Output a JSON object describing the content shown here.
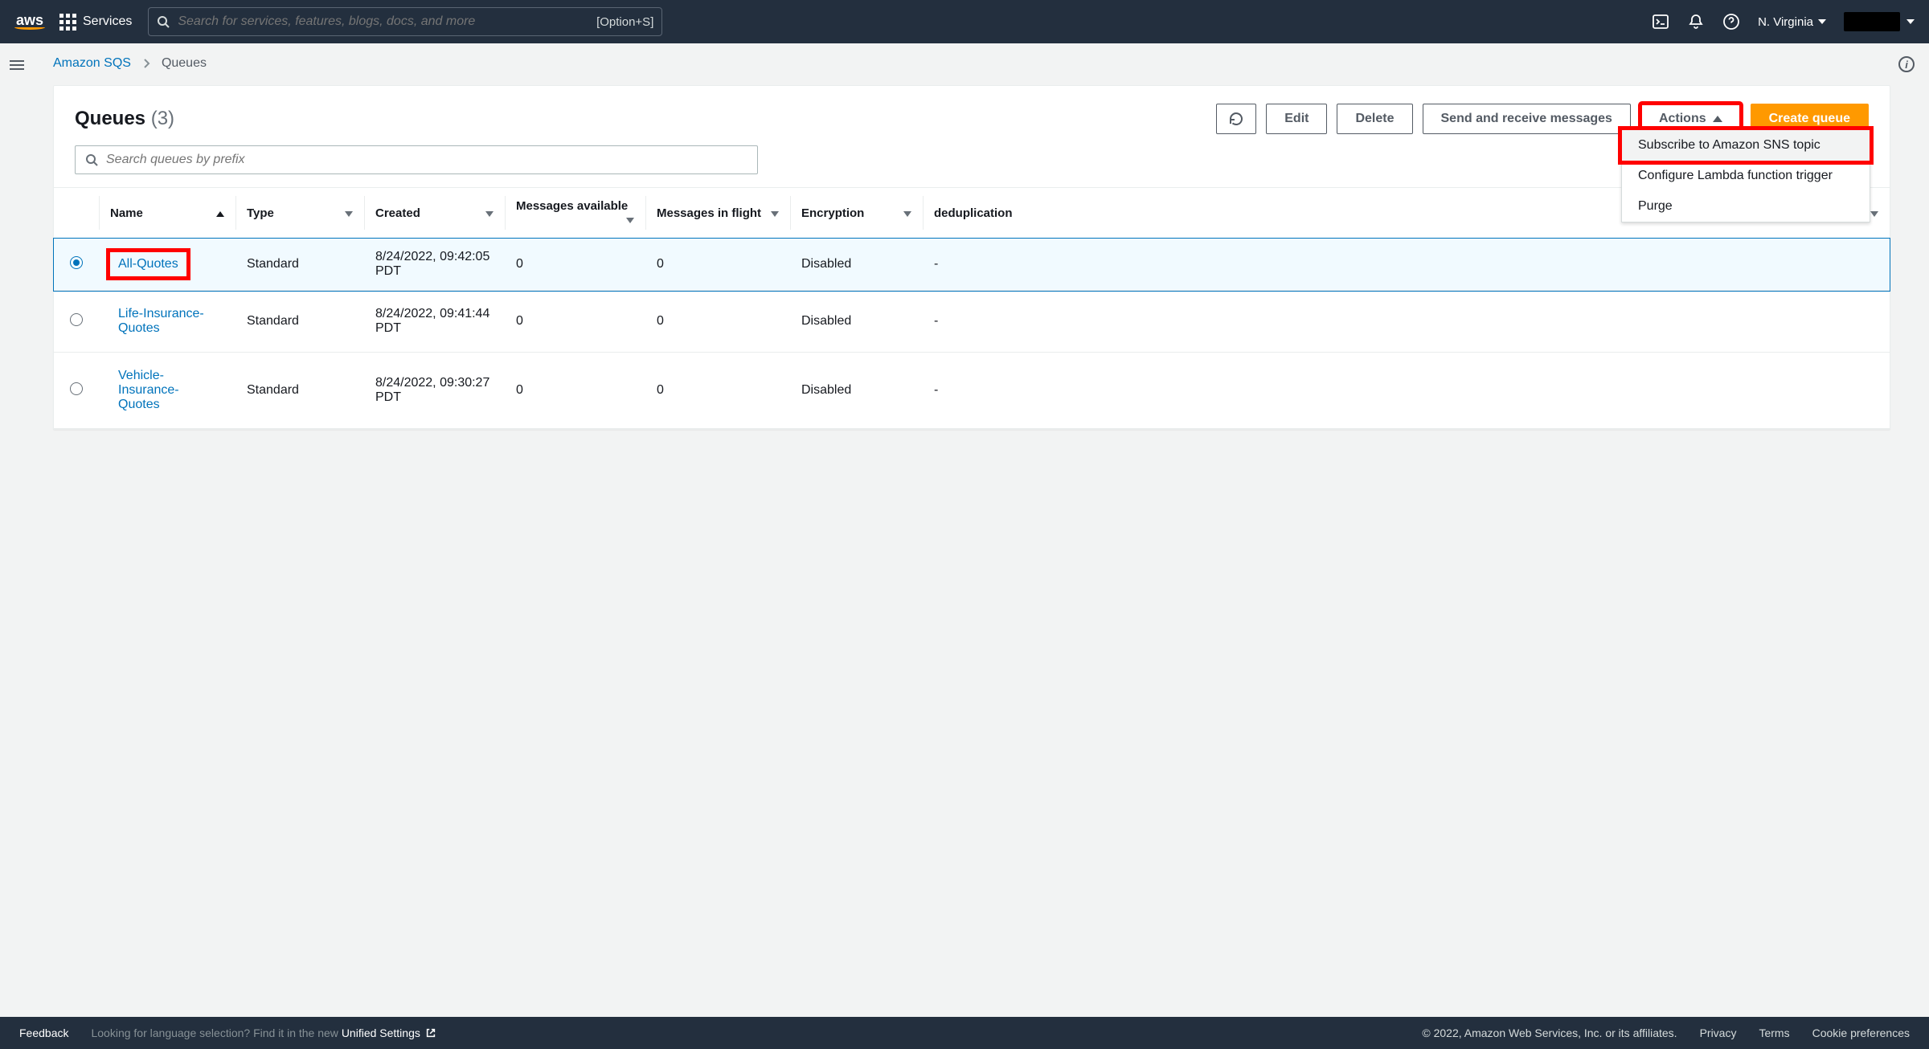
{
  "nav": {
    "logo": "aws",
    "services_label": "Services",
    "search_placeholder": "Search for services, features, blogs, docs, and more",
    "search_shortcut": "[Option+S]",
    "region": "N. Virginia"
  },
  "breadcrumb": {
    "root": "Amazon SQS",
    "current": "Queues"
  },
  "panel": {
    "title": "Queues",
    "count": "(3)",
    "buttons": {
      "edit": "Edit",
      "delete": "Delete",
      "send_receive": "Send and receive messages",
      "actions": "Actions",
      "create": "Create queue"
    },
    "actions_menu": {
      "subscribe": "Subscribe to Amazon SNS topic",
      "configure": "Configure Lambda function trigger",
      "purge": "Purge"
    },
    "queue_search_placeholder": "Search queues by prefix",
    "columns": {
      "name": "Name",
      "type": "Type",
      "created": "Created",
      "messages_available": "Messages available",
      "messages_in_flight": "Messages in flight",
      "encryption": "Encryption",
      "dedup": "deduplication"
    },
    "rows": [
      {
        "selected": true,
        "name": "All-Quotes",
        "type": "Standard",
        "created": "8/24/2022, 09:42:05 PDT",
        "avail": "0",
        "flight": "0",
        "encryption": "Disabled",
        "dedup": "-"
      },
      {
        "selected": false,
        "name": "Life-Insurance-Quotes",
        "type": "Standard",
        "created": "8/24/2022, 09:41:44 PDT",
        "avail": "0",
        "flight": "0",
        "encryption": "Disabled",
        "dedup": "-"
      },
      {
        "selected": false,
        "name": "Vehicle-Insurance-Quotes",
        "type": "Standard",
        "created": "8/24/2022, 09:30:27 PDT",
        "avail": "0",
        "flight": "0",
        "encryption": "Disabled",
        "dedup": "-"
      }
    ]
  },
  "footer": {
    "feedback": "Feedback",
    "lang_text": "Looking for language selection? Find it in the new ",
    "unified": "Unified Settings",
    "copyright": "© 2022, Amazon Web Services, Inc. or its affiliates.",
    "privacy": "Privacy",
    "terms": "Terms",
    "cookies": "Cookie preferences"
  }
}
